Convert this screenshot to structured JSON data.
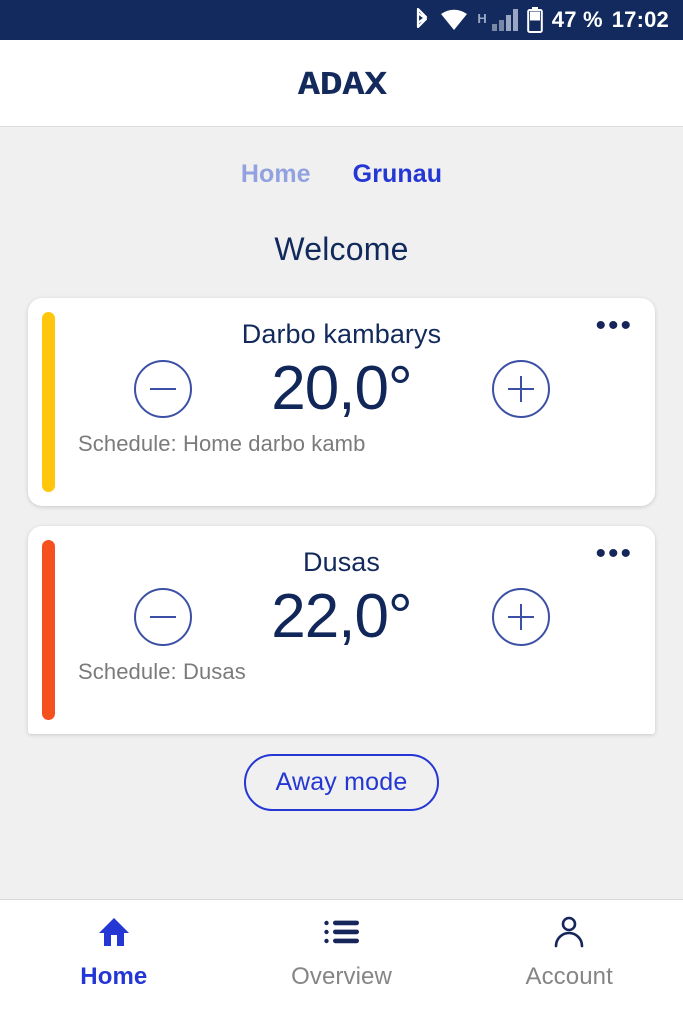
{
  "status_bar": {
    "bluetooth_icon": "bluetooth-icon",
    "wifi_icon": "wifi-icon",
    "network_type": "H",
    "signal_icon": "cellular-signal-icon",
    "battery_icon": "battery-icon",
    "battery_level": "47 %",
    "clock": "17:02"
  },
  "app_header": {
    "logo_text": "ADAX"
  },
  "tabs": {
    "items": [
      {
        "label": "Home",
        "active": false
      },
      {
        "label": "Grunau",
        "active": true
      }
    ]
  },
  "page_title": "Welcome",
  "rooms": [
    {
      "name": "Darbo kambarys",
      "temperature": "20,0°",
      "schedule": "Schedule: Home darbo kamb",
      "accent_color": "#FFC60B",
      "decrease_icon": "minus-circle-icon",
      "increase_icon": "plus-circle-icon",
      "menu_icon": "ellipsis-icon",
      "menu_glyph": "•••"
    },
    {
      "name": "Dusas",
      "temperature": "22,0°",
      "schedule": "Schedule: Dusas",
      "accent_color": "#F4511E",
      "decrease_icon": "minus-circle-icon",
      "increase_icon": "plus-circle-icon",
      "menu_icon": "ellipsis-icon",
      "menu_glyph": "•••"
    }
  ],
  "away_mode": {
    "label": "Away mode"
  },
  "bottom_nav": {
    "items": [
      {
        "label": "Home",
        "icon": "house-icon",
        "active": true
      },
      {
        "label": "Overview",
        "icon": "list-icon",
        "active": false
      },
      {
        "label": "Account",
        "icon": "person-icon",
        "active": false
      }
    ]
  },
  "colors": {
    "status_bar_bg": "#122A5E",
    "brand_navy": "#14295C",
    "accent_blue": "#2437D4",
    "muted_blue": "#92A2E0",
    "page_bg": "#F0F0F0",
    "muted_gray": "#7B7B7B"
  }
}
